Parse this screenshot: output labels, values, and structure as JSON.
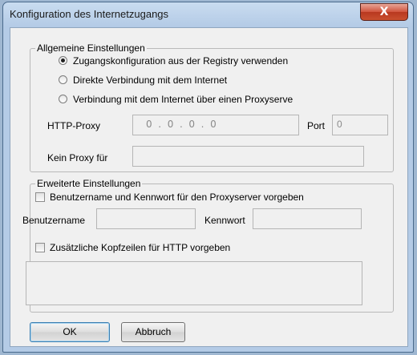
{
  "window": {
    "title": "Konfiguration des Internetzugangs",
    "close_glyph": "X"
  },
  "general": {
    "legend": "Allgemeine Einstellungen",
    "options": [
      {
        "label": "Zugangskonfiguration aus der Registry verwenden",
        "selected": true
      },
      {
        "label": "Direkte Verbindung mit dem Internet",
        "selected": false
      },
      {
        "label": "Verbindung mit dem Internet über einen Proxyserve",
        "selected": false
      }
    ],
    "http_proxy_label": "HTTP-Proxy",
    "http_proxy_value": "0  .  0  .  0  .  0",
    "port_label": "Port",
    "port_value": "0",
    "no_proxy_label": "Kein Proxy für",
    "no_proxy_value": ""
  },
  "advanced": {
    "legend": "Erweiterte Einstellungen",
    "credentials_checkbox_label": "Benutzername und Kennwort für den Proxyserver vorgeben",
    "credentials_checked": false,
    "username_label": "Benutzername",
    "username_value": "",
    "password_label": "Kennwort",
    "password_value": "",
    "headers_checkbox_label": "Zusätzliche Kopfzeilen für HTTP vorgeben",
    "headers_checked": false,
    "headers_value": ""
  },
  "buttons": {
    "ok": "OK",
    "cancel": "Abbruch"
  }
}
